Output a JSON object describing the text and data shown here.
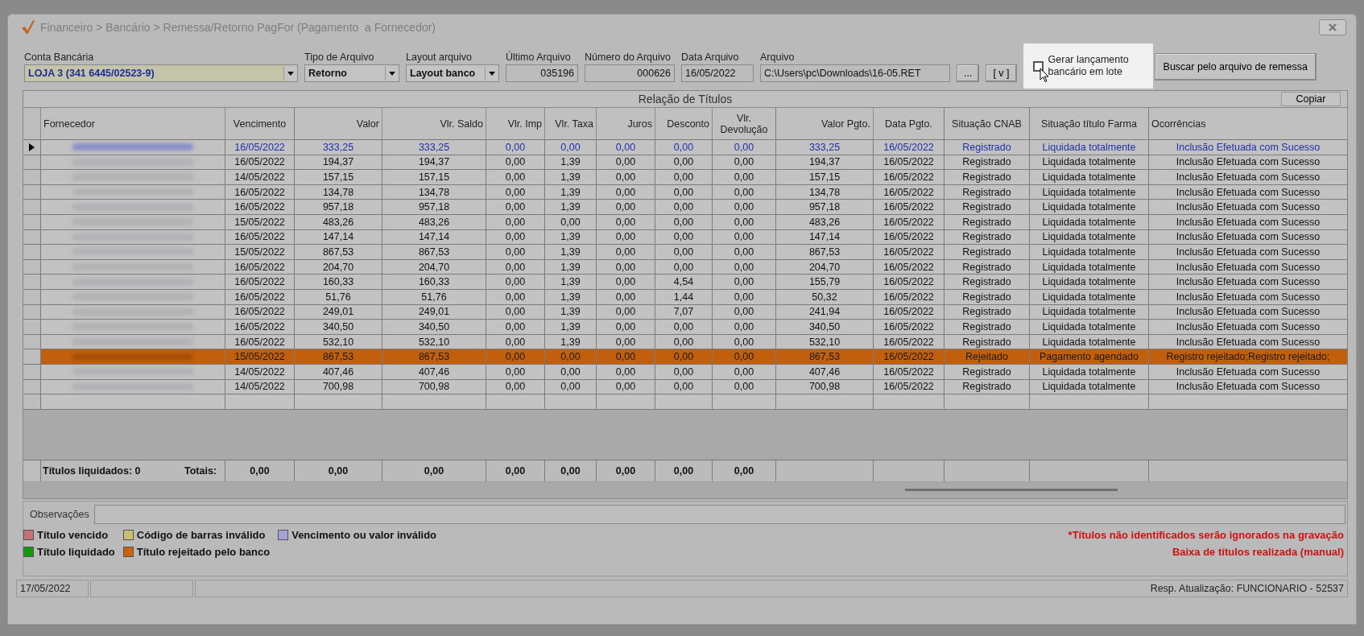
{
  "window": {
    "breadcrumb": "Financeiro > Bancário > Remessa/Retorno PagFor (Pagamento  a Fornecedor)"
  },
  "form": {
    "account": {
      "label": "Conta Bancária",
      "value": "LOJA 3 (341 6445/02523-9)"
    },
    "file_type": {
      "label": "Tipo de Arquivo",
      "value": "Retorno"
    },
    "layout": {
      "label": "Layout arquivo",
      "value": "Layout banco"
    },
    "last_file": {
      "label": "Último Arquivo",
      "value": "035196"
    },
    "file_number": {
      "label": "Número do Arquivo",
      "value": "000626"
    },
    "file_date": {
      "label": "Data Arquivo",
      "value": "16/05/2022"
    },
    "file": {
      "label": "Arquivo",
      "value": "C:\\Users\\pc\\Downloads\\16-05.RET"
    },
    "browse_button": "...",
    "view_button": "[ v ]",
    "batch_checkbox": {
      "label": "Gerar lançamento bancário em lote",
      "checked": false
    },
    "search_button": "Buscar pelo arquivo de remessa"
  },
  "table": {
    "title": "Relação de Títulos",
    "copy_button": "Copiar",
    "columns": [
      "Fornecedor",
      "Vencimento",
      "Valor",
      "Vlr. Saldo",
      "Vlr. Imp",
      "Vlr. Taxa",
      "Juros",
      "Desconto",
      "Vlr. Devolução",
      "Valor Pgto.",
      "Data Pgto.",
      "Situação CNAB",
      "Situação título Farma",
      "Ocorrências"
    ],
    "rows": [
      {
        "selected": true,
        "rejected": false,
        "cells": [
          "",
          "16/05/2022",
          "333,25",
          "333,25",
          "0,00",
          "0,00",
          "0,00",
          "0,00",
          "0,00",
          "333,25",
          "16/05/2022",
          "Registrado",
          "Liquidada totalmente",
          "Inclusão Efetuada com Sucesso"
        ]
      },
      {
        "selected": false,
        "rejected": false,
        "cells": [
          "",
          "16/05/2022",
          "194,37",
          "194,37",
          "0,00",
          "1,39",
          "0,00",
          "0,00",
          "0,00",
          "194,37",
          "16/05/2022",
          "Registrado",
          "Liquidada totalmente",
          "Inclusão Efetuada com Sucesso"
        ]
      },
      {
        "selected": false,
        "rejected": false,
        "cells": [
          "",
          "14/05/2022",
          "157,15",
          "157,15",
          "0,00",
          "1,39",
          "0,00",
          "0,00",
          "0,00",
          "157,15",
          "16/05/2022",
          "Registrado",
          "Liquidada totalmente",
          "Inclusão Efetuada com Sucesso"
        ]
      },
      {
        "selected": false,
        "rejected": false,
        "cells": [
          "",
          "16/05/2022",
          "134,78",
          "134,78",
          "0,00",
          "1,39",
          "0,00",
          "0,00",
          "0,00",
          "134,78",
          "16/05/2022",
          "Registrado",
          "Liquidada totalmente",
          "Inclusão Efetuada com Sucesso"
        ]
      },
      {
        "selected": false,
        "rejected": false,
        "cells": [
          "",
          "16/05/2022",
          "957,18",
          "957,18",
          "0,00",
          "1,39",
          "0,00",
          "0,00",
          "0,00",
          "957,18",
          "16/05/2022",
          "Registrado",
          "Liquidada totalmente",
          "Inclusão Efetuada com Sucesso"
        ]
      },
      {
        "selected": false,
        "rejected": false,
        "cells": [
          "",
          "15/05/2022",
          "483,26",
          "483,26",
          "0,00",
          "0,00",
          "0,00",
          "0,00",
          "0,00",
          "483,26",
          "16/05/2022",
          "Registrado",
          "Liquidada totalmente",
          "Inclusão Efetuada com Sucesso"
        ]
      },
      {
        "selected": false,
        "rejected": false,
        "cells": [
          "",
          "16/05/2022",
          "147,14",
          "147,14",
          "0,00",
          "1,39",
          "0,00",
          "0,00",
          "0,00",
          "147,14",
          "16/05/2022",
          "Registrado",
          "Liquidada totalmente",
          "Inclusão Efetuada com Sucesso"
        ]
      },
      {
        "selected": false,
        "rejected": false,
        "cells": [
          "",
          "15/05/2022",
          "867,53",
          "867,53",
          "0,00",
          "1,39",
          "0,00",
          "0,00",
          "0,00",
          "867,53",
          "16/05/2022",
          "Registrado",
          "Liquidada totalmente",
          "Inclusão Efetuada com Sucesso"
        ]
      },
      {
        "selected": false,
        "rejected": false,
        "cells": [
          "",
          "16/05/2022",
          "204,70",
          "204,70",
          "0,00",
          "1,39",
          "0,00",
          "0,00",
          "0,00",
          "204,70",
          "16/05/2022",
          "Registrado",
          "Liquidada totalmente",
          "Inclusão Efetuada com Sucesso"
        ]
      },
      {
        "selected": false,
        "rejected": false,
        "cells": [
          "",
          "16/05/2022",
          "160,33",
          "160,33",
          "0,00",
          "1,39",
          "0,00",
          "4,54",
          "0,00",
          "155,79",
          "16/05/2022",
          "Registrado",
          "Liquidada totalmente",
          "Inclusão Efetuada com Sucesso"
        ]
      },
      {
        "selected": false,
        "rejected": false,
        "cells": [
          "",
          "16/05/2022",
          "51,76",
          "51,76",
          "0,00",
          "1,39",
          "0,00",
          "1,44",
          "0,00",
          "50,32",
          "16/05/2022",
          "Registrado",
          "Liquidada totalmente",
          "Inclusão Efetuada com Sucesso"
        ]
      },
      {
        "selected": false,
        "rejected": false,
        "cells": [
          "",
          "16/05/2022",
          "249,01",
          "249,01",
          "0,00",
          "1,39",
          "0,00",
          "7,07",
          "0,00",
          "241,94",
          "16/05/2022",
          "Registrado",
          "Liquidada totalmente",
          "Inclusão Efetuada com Sucesso"
        ]
      },
      {
        "selected": false,
        "rejected": false,
        "cells": [
          "",
          "16/05/2022",
          "340,50",
          "340,50",
          "0,00",
          "1,39",
          "0,00",
          "0,00",
          "0,00",
          "340,50",
          "16/05/2022",
          "Registrado",
          "Liquidada totalmente",
          "Inclusão Efetuada com Sucesso"
        ]
      },
      {
        "selected": false,
        "rejected": false,
        "cells": [
          "",
          "16/05/2022",
          "532,10",
          "532,10",
          "0,00",
          "1,39",
          "0,00",
          "0,00",
          "0,00",
          "532,10",
          "16/05/2022",
          "Registrado",
          "Liquidada totalmente",
          "Inclusão Efetuada com Sucesso"
        ]
      },
      {
        "selected": false,
        "rejected": true,
        "cells": [
          "",
          "15/05/2022",
          "867,53",
          "867,53",
          "0,00",
          "0,00",
          "0,00",
          "0,00",
          "0,00",
          "867,53",
          "16/05/2022",
          "Rejeitado",
          "Pagamento agendado",
          "Registro rejeitado;Registro rejeitado;"
        ]
      },
      {
        "selected": false,
        "rejected": false,
        "cells": [
          "",
          "14/05/2022",
          "407,46",
          "407,46",
          "0,00",
          "0,00",
          "0,00",
          "0,00",
          "0,00",
          "407,46",
          "16/05/2022",
          "Registrado",
          "Liquidada totalmente",
          "Inclusão Efetuada com Sucesso"
        ]
      },
      {
        "selected": false,
        "rejected": false,
        "cells": [
          "",
          "14/05/2022",
          "700,98",
          "700,98",
          "0,00",
          "0,00",
          "0,00",
          "0,00",
          "0,00",
          "700,98",
          "16/05/2022",
          "Registrado",
          "Liquidada totalmente",
          "Inclusão Efetuada com Sucesso"
        ]
      }
    ],
    "footer": {
      "settled": "Títulos liquidados: 0",
      "totals_label": "Totais:",
      "totals": [
        "0,00",
        "0,00",
        "0,00",
        "0,00",
        "0,00",
        "0,00",
        "0,00",
        "0,00"
      ]
    }
  },
  "observations": {
    "label": "Observações"
  },
  "legend": [
    {
      "label": "Título vencido",
      "color": "#c27272"
    },
    {
      "label": "Código de barras inválido",
      "color": "#c8c070"
    },
    {
      "label": "Vencimento ou valor inválido",
      "color": "#a4a4d4"
    },
    {
      "label": "Título liquidado",
      "color": "#109a10"
    },
    {
      "label": "Título rejeitado pelo banco",
      "color": "#c8620e"
    }
  ],
  "notes": [
    "*Títulos não identificados serão ignorados na gravação",
    "Baixa de títulos realizada (manual)"
  ],
  "status_bar": {
    "date": "17/05/2022",
    "user": "Resp. Atualização: FUNCIONARIO - 52537"
  }
}
